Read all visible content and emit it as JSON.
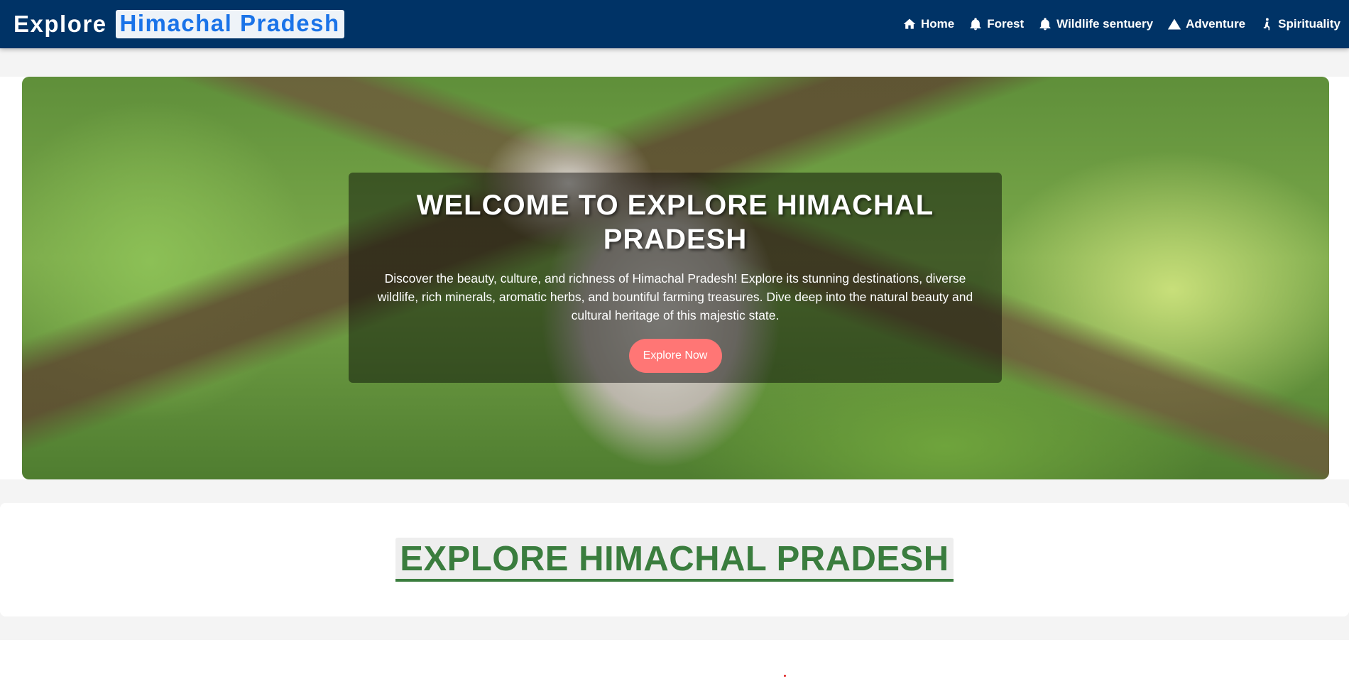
{
  "brand": {
    "plain": "Explore",
    "highlight": "Himachal Pradesh"
  },
  "nav": [
    {
      "label": "Home",
      "icon": "home-icon"
    },
    {
      "label": "Forest",
      "icon": "bell-icon"
    },
    {
      "label": "Wildlife sentuery",
      "icon": "bell-icon"
    },
    {
      "label": "Adventure",
      "icon": "mountain-icon"
    },
    {
      "label": "Spirituality",
      "icon": "praying-person-icon"
    }
  ],
  "hero": {
    "title": "WELCOME TO EXPLORE HIMACHAL PRADESH",
    "description": "Discover the beauty, culture, and richness of Himachal Pradesh! Explore its stunning destinations, diverse wildlife, rich minerals, aromatic herbs, and bountiful farming treasures. Dive deep into the natural beauty and cultural heritage of this majestic state.",
    "cta_label": "Explore Now",
    "background_image": "snow-leopard-on-branch"
  },
  "section": {
    "title": "EXPLORE HIMACHAL PRADESH"
  },
  "colors": {
    "navbar": "#003366",
    "brand_highlight": "#1a73e8",
    "cta": "#ff7675",
    "section_title": "#3a7d3e"
  }
}
